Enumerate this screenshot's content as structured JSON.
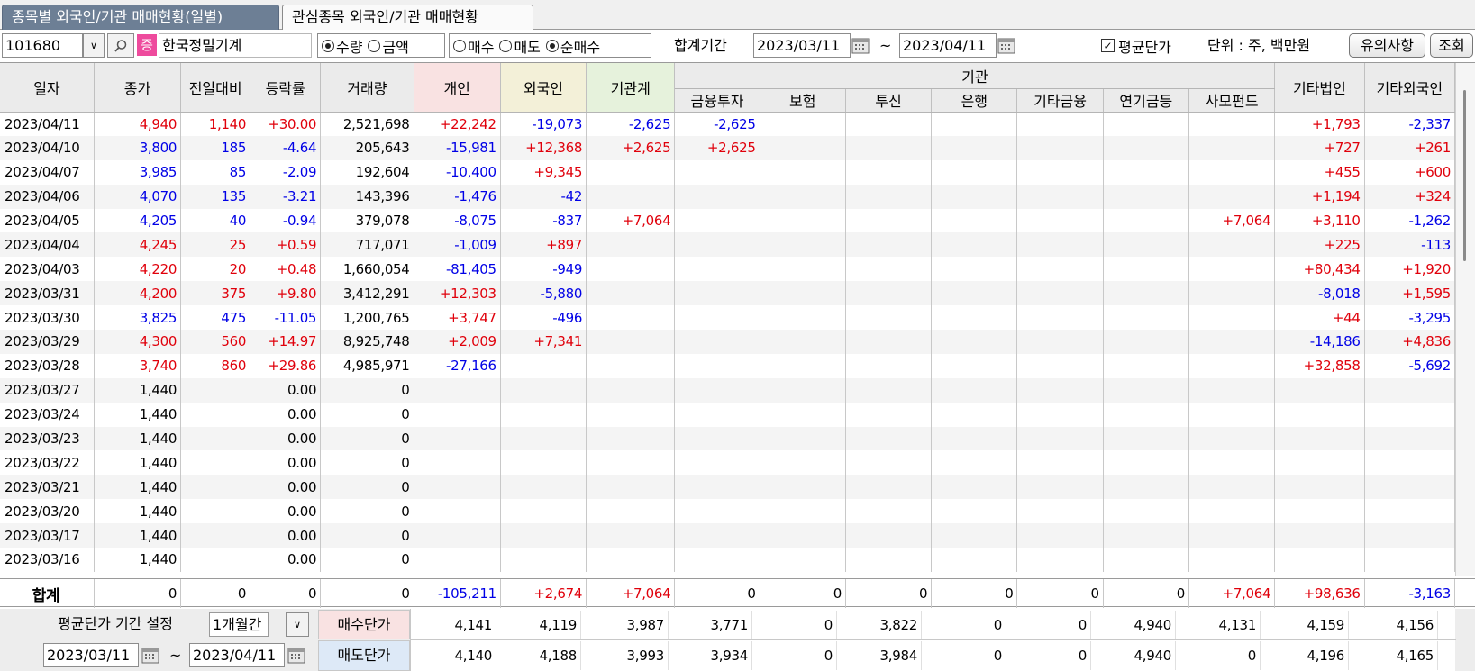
{
  "tabs": {
    "active": "종목별 외국인/기관 매매현황(일별)",
    "inactive": "관심종목 외국인/기관 매매현황"
  },
  "toolbar": {
    "code": "101680",
    "market_badge": "증",
    "stock_name": "한국정밀기계",
    "unit_type": {
      "qty": "수량",
      "amount": "금액",
      "selected": "수량"
    },
    "trade_type": {
      "buy": "매수",
      "sell": "매도",
      "net": "순매수",
      "selected": "순매수"
    },
    "period_label": "합계기간",
    "date_from": "2023/03/11",
    "tilde": "~",
    "date_to": "2023/04/11",
    "avg_price_label": "평균단가",
    "avg_price_checked": true,
    "unit_label": "단위 : 주, 백만원",
    "notice_button": "유의사항",
    "search_button": "조회"
  },
  "headers": {
    "date": "일자",
    "close": "종가",
    "change": "전일대비",
    "rate": "등락률",
    "volume": "거래량",
    "individual": "개인",
    "foreign": "외국인",
    "institution_total": "기관계",
    "institution_group": "기관",
    "institution_sub": [
      "금융투자",
      "보험",
      "투신",
      "은행",
      "기타금융",
      "연기금등",
      "사모펀드"
    ],
    "other_corp": "기타법인",
    "other_foreign": "기타외국인"
  },
  "rows": [
    [
      "2023/04/11",
      "4,940",
      "1,140",
      "+30.00",
      "2,521,698",
      "+22,242",
      "-19,073",
      "-2,625",
      "-2,625",
      "",
      "",
      "",
      "",
      "",
      "",
      "+1,793",
      "-2,337"
    ],
    [
      "2023/04/10",
      "3,800",
      "185",
      "-4.64",
      "205,643",
      "-15,981",
      "+12,368",
      "+2,625",
      "+2,625",
      "",
      "",
      "",
      "",
      "",
      "",
      "+727",
      "+261"
    ],
    [
      "2023/04/07",
      "3,985",
      "85",
      "-2.09",
      "192,604",
      "-10,400",
      "+9,345",
      "",
      "",
      "",
      "",
      "",
      "",
      "",
      "",
      "+455",
      "+600"
    ],
    [
      "2023/04/06",
      "4,070",
      "135",
      "-3.21",
      "143,396",
      "-1,476",
      "-42",
      "",
      "",
      "",
      "",
      "",
      "",
      "",
      "",
      "+1,194",
      "+324"
    ],
    [
      "2023/04/05",
      "4,205",
      "40",
      "-0.94",
      "379,078",
      "-8,075",
      "-837",
      "+7,064",
      "",
      "",
      "",
      "",
      "",
      "",
      "+7,064",
      "+3,110",
      "-1,262"
    ],
    [
      "2023/04/04",
      "4,245",
      "25",
      "+0.59",
      "717,071",
      "-1,009",
      "+897",
      "",
      "",
      "",
      "",
      "",
      "",
      "",
      "",
      "+225",
      "-113"
    ],
    [
      "2023/04/03",
      "4,220",
      "20",
      "+0.48",
      "1,660,054",
      "-81,405",
      "-949",
      "",
      "",
      "",
      "",
      "",
      "",
      "",
      "",
      "+80,434",
      "+1,920"
    ],
    [
      "2023/03/31",
      "4,200",
      "375",
      "+9.80",
      "3,412,291",
      "+12,303",
      "-5,880",
      "",
      "",
      "",
      "",
      "",
      "",
      "",
      "",
      "-8,018",
      "+1,595"
    ],
    [
      "2023/03/30",
      "3,825",
      "475",
      "-11.05",
      "1,200,765",
      "+3,747",
      "-496",
      "",
      "",
      "",
      "",
      "",
      "",
      "",
      "",
      "+44",
      "-3,295"
    ],
    [
      "2023/03/29",
      "4,300",
      "560",
      "+14.97",
      "8,925,748",
      "+2,009",
      "+7,341",
      "",
      "",
      "",
      "",
      "",
      "",
      "",
      "",
      "-14,186",
      "+4,836"
    ],
    [
      "2023/03/28",
      "3,740",
      "860",
      "+29.86",
      "4,985,971",
      "-27,166",
      "",
      "",
      "",
      "",
      "",
      "",
      "",
      "",
      "",
      "+32,858",
      "-5,692"
    ],
    [
      "2023/03/27",
      "1,440",
      "",
      "0.00",
      "0",
      "",
      "",
      "",
      "",
      "",
      "",
      "",
      "",
      "",
      "",
      "",
      ""
    ],
    [
      "2023/03/24",
      "1,440",
      "",
      "0.00",
      "0",
      "",
      "",
      "",
      "",
      "",
      "",
      "",
      "",
      "",
      "",
      "",
      ""
    ],
    [
      "2023/03/23",
      "1,440",
      "",
      "0.00",
      "0",
      "",
      "",
      "",
      "",
      "",
      "",
      "",
      "",
      "",
      "",
      "",
      ""
    ],
    [
      "2023/03/22",
      "1,440",
      "",
      "0.00",
      "0",
      "",
      "",
      "",
      "",
      "",
      "",
      "",
      "",
      "",
      "",
      "",
      ""
    ],
    [
      "2023/03/21",
      "1,440",
      "",
      "0.00",
      "0",
      "",
      "",
      "",
      "",
      "",
      "",
      "",
      "",
      "",
      "",
      "",
      ""
    ],
    [
      "2023/03/20",
      "1,440",
      "",
      "0.00",
      "0",
      "",
      "",
      "",
      "",
      "",
      "",
      "",
      "",
      "",
      "",
      "",
      ""
    ],
    [
      "2023/03/17",
      "1,440",
      "",
      "0.00",
      "0",
      "",
      "",
      "",
      "",
      "",
      "",
      "",
      "",
      "",
      "",
      "",
      ""
    ],
    [
      "2023/03/16",
      "1,440",
      "",
      "0.00",
      "0",
      "",
      "",
      "",
      "",
      "",
      "",
      "",
      "",
      "",
      "",
      "",
      ""
    ]
  ],
  "row_colors": [
    [
      "k",
      "r",
      "r",
      "r",
      "k",
      "r",
      "b",
      "b",
      "b",
      "",
      "",
      "",
      "",
      "",
      "",
      "r",
      "b"
    ],
    [
      "k",
      "b",
      "b",
      "b",
      "k",
      "b",
      "r",
      "r",
      "r",
      "",
      "",
      "",
      "",
      "",
      "",
      "r",
      "r"
    ],
    [
      "k",
      "b",
      "b",
      "b",
      "k",
      "b",
      "r",
      "",
      "",
      "",
      "",
      "",
      "",
      "",
      "",
      "r",
      "r"
    ],
    [
      "k",
      "b",
      "b",
      "b",
      "k",
      "b",
      "b",
      "",
      "",
      "",
      "",
      "",
      "",
      "",
      "",
      "r",
      "r"
    ],
    [
      "k",
      "b",
      "b",
      "b",
      "k",
      "b",
      "b",
      "r",
      "",
      "",
      "",
      "",
      "",
      "",
      "r",
      "r",
      "b"
    ],
    [
      "k",
      "r",
      "r",
      "r",
      "k",
      "b",
      "r",
      "",
      "",
      "",
      "",
      "",
      "",
      "",
      "",
      "r",
      "b"
    ],
    [
      "k",
      "r",
      "r",
      "r",
      "k",
      "b",
      "b",
      "",
      "",
      "",
      "",
      "",
      "",
      "",
      "",
      "r",
      "r"
    ],
    [
      "k",
      "r",
      "r",
      "r",
      "k",
      "r",
      "b",
      "",
      "",
      "",
      "",
      "",
      "",
      "",
      "",
      "b",
      "r"
    ],
    [
      "k",
      "b",
      "b",
      "b",
      "k",
      "r",
      "b",
      "",
      "",
      "",
      "",
      "",
      "",
      "",
      "",
      "r",
      "b"
    ],
    [
      "k",
      "r",
      "r",
      "r",
      "k",
      "r",
      "r",
      "",
      "",
      "",
      "",
      "",
      "",
      "",
      "",
      "b",
      "r"
    ],
    [
      "k",
      "r",
      "r",
      "r",
      "k",
      "b",
      "",
      "",
      "",
      "",
      "",
      "",
      "",
      "",
      "",
      "r",
      "b"
    ],
    [
      "k",
      "k",
      "k",
      "k",
      "k",
      "",
      "",
      "",
      "",
      "",
      "",
      "",
      "",
      "",
      "",
      "",
      ""
    ],
    [
      "k",
      "k",
      "k",
      "k",
      "k",
      "",
      "",
      "",
      "",
      "",
      "",
      "",
      "",
      "",
      "",
      "",
      ""
    ],
    [
      "k",
      "k",
      "k",
      "k",
      "k",
      "",
      "",
      "",
      "",
      "",
      "",
      "",
      "",
      "",
      "",
      "",
      ""
    ],
    [
      "k",
      "k",
      "k",
      "k",
      "k",
      "",
      "",
      "",
      "",
      "",
      "",
      "",
      "",
      "",
      "",
      "",
      ""
    ],
    [
      "k",
      "k",
      "k",
      "k",
      "k",
      "",
      "",
      "",
      "",
      "",
      "",
      "",
      "",
      "",
      "",
      "",
      ""
    ],
    [
      "k",
      "k",
      "k",
      "k",
      "k",
      "",
      "",
      "",
      "",
      "",
      "",
      "",
      "",
      "",
      "",
      "",
      ""
    ],
    [
      "k",
      "k",
      "k",
      "k",
      "k",
      "",
      "",
      "",
      "",
      "",
      "",
      "",
      "",
      "",
      "",
      "",
      ""
    ],
    [
      "k",
      "k",
      "k",
      "k",
      "k",
      "",
      "",
      "",
      "",
      "",
      "",
      "",
      "",
      "",
      "",
      "",
      ""
    ]
  ],
  "sum_row": {
    "label": "합계",
    "values": [
      "0",
      "0",
      "0",
      "0",
      "-105,211",
      "+2,674",
      "+7,064",
      "0",
      "0",
      "0",
      "0",
      "0",
      "0",
      "+7,064",
      "+98,636",
      "-3,163"
    ],
    "colors": [
      "k",
      "k",
      "k",
      "k",
      "b",
      "r",
      "r",
      "k",
      "k",
      "k",
      "k",
      "k",
      "k",
      "r",
      "r",
      "b"
    ]
  },
  "avg_section": {
    "period_label": "평균단가 기간 설정",
    "period_value": "1개월간",
    "date_from": "2023/03/11",
    "tilde": "~",
    "date_to": "2023/04/11",
    "buy_label": "매수단가",
    "sell_label": "매도단가",
    "buy_values": [
      "4,141",
      "4,119",
      "3,987",
      "3,771",
      "0",
      "3,822",
      "0",
      "0",
      "4,940",
      "4,131",
      "4,159",
      "4,156"
    ],
    "sell_values": [
      "4,140",
      "4,188",
      "3,993",
      "3,934",
      "0",
      "3,984",
      "0",
      "0",
      "4,940",
      "0",
      "4,196",
      "4,165"
    ]
  },
  "colors": {
    "red": "#e0000b",
    "blue": "#0000e6",
    "tab_active": "#6d7f95",
    "pink_header": "#f9e2e2",
    "yellow_header": "#f3f0d8",
    "green_header": "#e6f2dc"
  }
}
